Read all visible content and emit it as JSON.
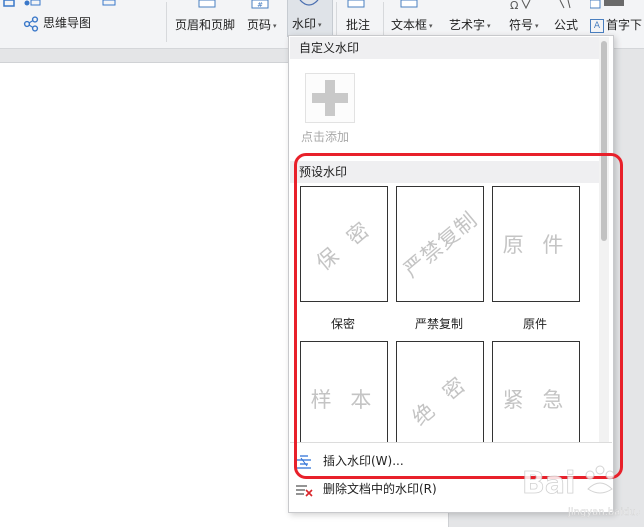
{
  "ribbon": {
    "mind_map_label": "思维导图",
    "header_footer_label": "页眉和页脚",
    "page_number_label": "页码",
    "watermark_label": "水印",
    "comment_label": "批注",
    "textbox_label": "文本框",
    "wordart_label": "艺术字",
    "symbol_label": "符号",
    "formula_label": "公式",
    "drop_cap_label": "首字下",
    "dropdown_arrow": "▾"
  },
  "dropdown": {
    "custom_header": "自定义水印",
    "add_label": "点击添加",
    "preset_header": "预设水印",
    "presets": [
      {
        "label": "保密",
        "text": "保 密",
        "rotation_deg": -40
      },
      {
        "label": "严禁复制",
        "text": "严禁复制",
        "rotation_deg": -40
      },
      {
        "label": "原件",
        "text": "原 件",
        "rotation_deg": 0
      },
      {
        "label": "",
        "text": "样 本",
        "rotation_deg": 0
      },
      {
        "label": "",
        "text": "绝 密",
        "rotation_deg": -40
      },
      {
        "label": "",
        "text": "紧 急",
        "rotation_deg": 0
      }
    ],
    "insert_label": "插入水印(W)...",
    "delete_label": "删除文档中的水印(R)"
  },
  "overlay": {
    "highlight_color": "#e8202a",
    "logo_text": "Bai",
    "logo_sub": "jingyan.baidu.com"
  },
  "colors": {
    "accent_blue": "#2b6fd6",
    "delete_red": "#d9262b"
  }
}
